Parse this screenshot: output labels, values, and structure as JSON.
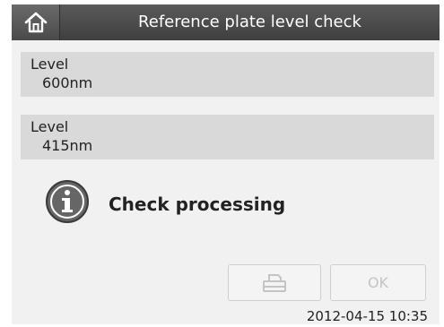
{
  "header": {
    "title": "Reference plate level check",
    "home_icon": "home-icon"
  },
  "levels": [
    {
      "label": "Level",
      "value": "600nm"
    },
    {
      "label": "Level",
      "value": "415nm"
    }
  ],
  "status": {
    "icon": "info-icon",
    "text": "Check processing"
  },
  "buttons": {
    "print_icon": "printer-icon",
    "ok_label": "OK"
  },
  "footer": {
    "datetime": "2012-04-15 10:35"
  },
  "colors": {
    "title_bar": "#4a4a4a",
    "panel": "#d9d9d9",
    "background": "#f1f1f1",
    "disabled_text": "#c4c4c4"
  }
}
